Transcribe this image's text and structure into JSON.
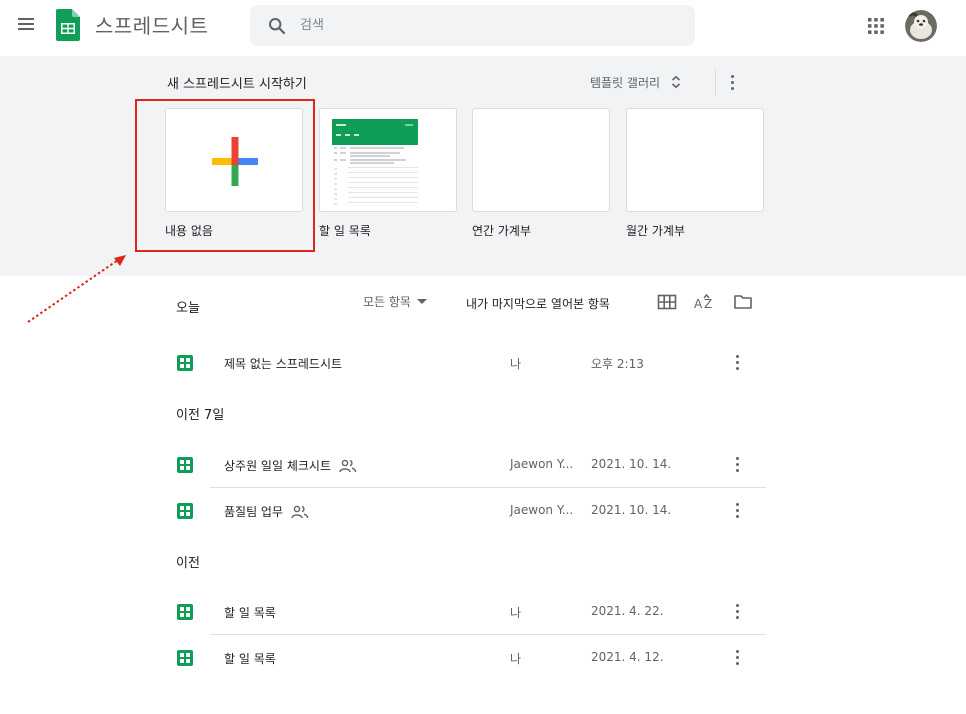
{
  "header": {
    "app_title": "스프레드시트",
    "search_placeholder": "검색"
  },
  "gallery": {
    "title": "새 스프레드시트 시작하기",
    "toggle_label": "템플릿 갤러리",
    "templates": [
      {
        "label": "내용 없음",
        "kind": "blank"
      },
      {
        "label": "할 일 목록",
        "kind": "todo"
      },
      {
        "label": "연간 가계부",
        "kind": "empty"
      },
      {
        "label": "월간 가계부",
        "kind": "empty"
      }
    ]
  },
  "list": {
    "owner_filter": "모든 항목",
    "sort_label": "내가 마지막으로 열어본 항목",
    "sections": [
      {
        "label": "오늘",
        "rows": [
          {
            "name": "제목 없는 스프레드시트",
            "shared": false,
            "owner": "나",
            "date": "오후 2:13"
          }
        ]
      },
      {
        "label": "이전 7일",
        "rows": [
          {
            "name": "상주원 일일 체크시트",
            "shared": true,
            "owner": "Jaewon Y...",
            "date": "2021. 10. 14."
          },
          {
            "name": "품질팀 업무",
            "shared": true,
            "owner": "Jaewon Y...",
            "date": "2021. 10. 14."
          }
        ]
      },
      {
        "label": "이전",
        "rows": [
          {
            "name": "할 일 목록",
            "shared": false,
            "owner": "나",
            "date": "2021. 4. 22."
          },
          {
            "name": "할 일 목록",
            "shared": false,
            "owner": "나",
            "date": "2021. 4. 12."
          }
        ]
      }
    ]
  },
  "colors": {
    "sheets_green": "#0f9d58",
    "highlight_red": "#e0241a",
    "plus_blue": "#4285f4",
    "plus_red": "#ea4335",
    "plus_yellow": "#fbbc04",
    "plus_green": "#34a853"
  }
}
